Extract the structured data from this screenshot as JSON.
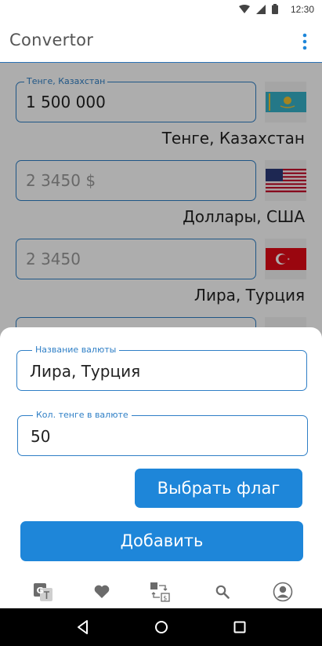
{
  "status_bar": {
    "time": "12:30"
  },
  "app_bar": {
    "title": "Convertor"
  },
  "currencies": [
    {
      "label": "Тенге, Казахстан",
      "value": "1 500 000",
      "name": "Тенге, Казахстан",
      "flag": "kazakhstan-flag"
    },
    {
      "label": "",
      "value": "2 3450 $",
      "name": "Доллары, США",
      "flag": "usa-flag"
    },
    {
      "label": "",
      "value": "2 3450",
      "name": "Лира, Турция",
      "flag": "turkey-flag"
    }
  ],
  "sheet": {
    "name_field": {
      "label": "Название валюты",
      "value": "Лира, Турция"
    },
    "rate_field": {
      "label": "Кол. тенге в валюте",
      "value": "50"
    },
    "choose_flag_label": "Выбрать флаг",
    "add_label": "Добавить"
  },
  "bottom_nav": [
    "translate-icon",
    "heart-icon",
    "exchange-icon",
    "search-icon",
    "account-icon"
  ],
  "colors": {
    "accent": "#1e86d9",
    "border": "#2f7fc6"
  }
}
